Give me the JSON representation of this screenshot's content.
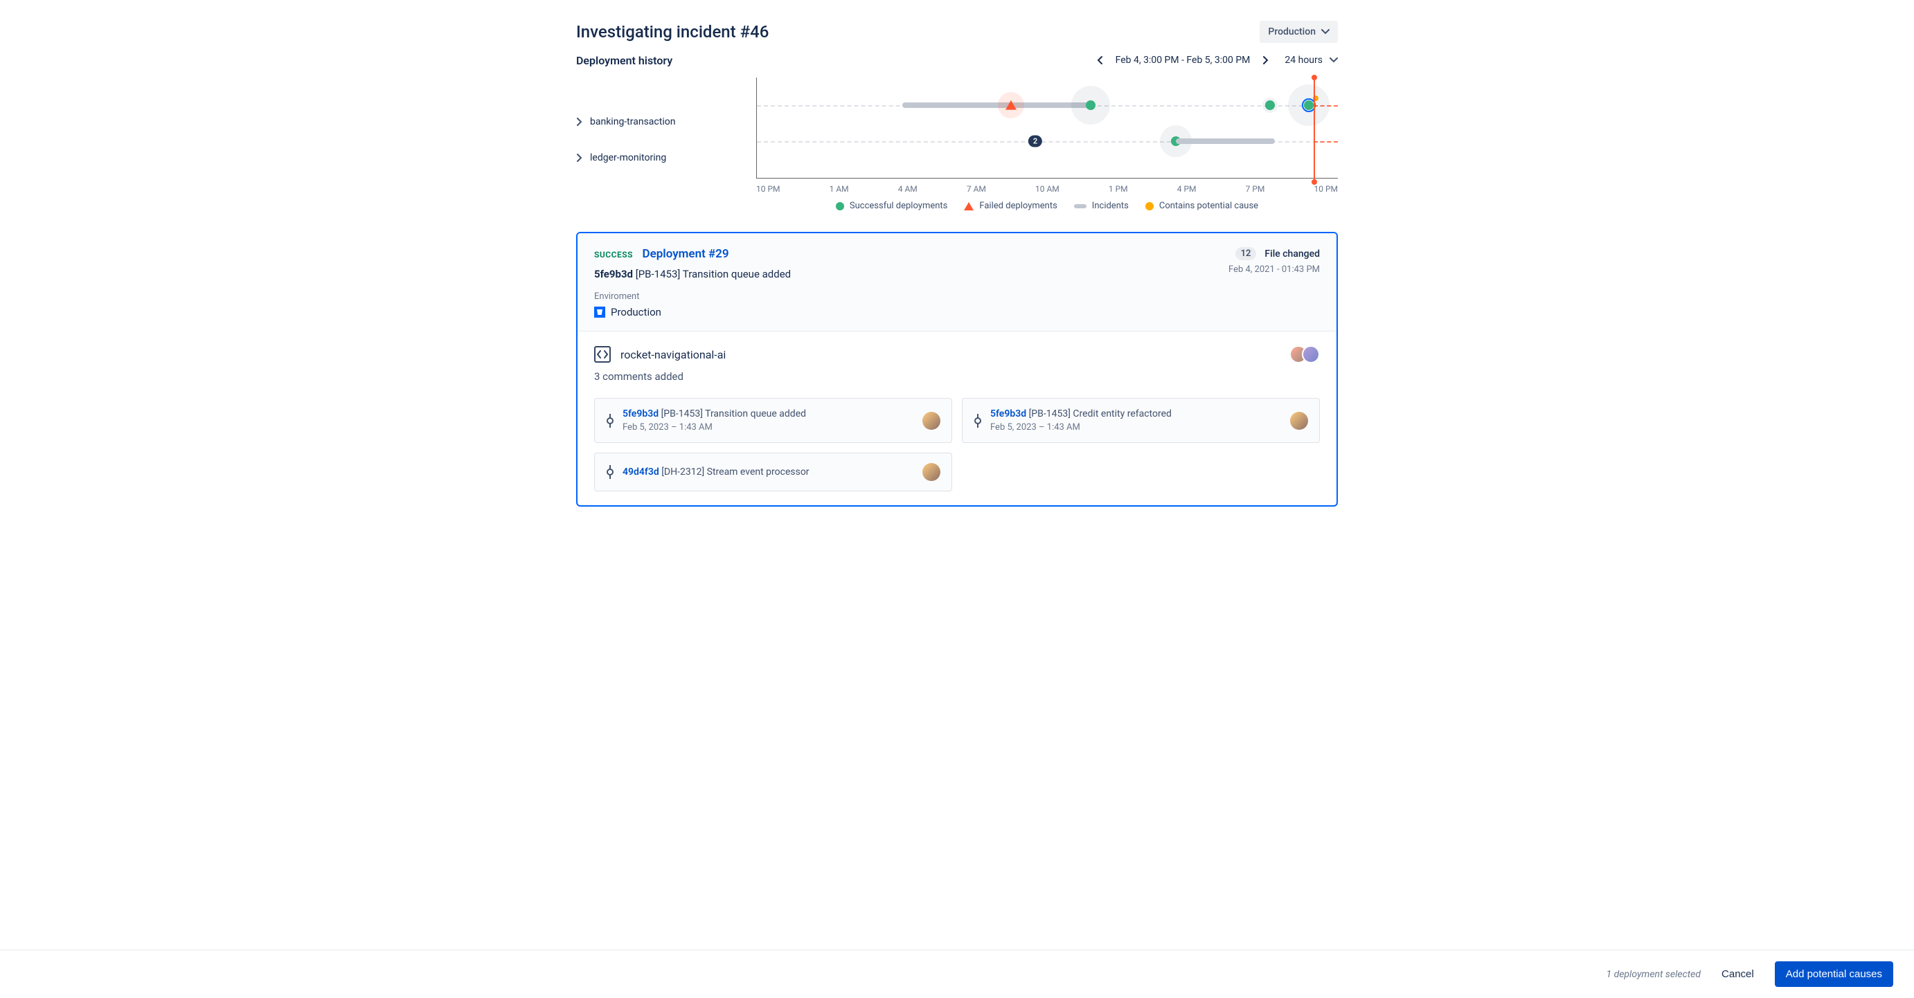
{
  "header": {
    "title": "Investigating incident #46",
    "env_select": "Production"
  },
  "subheader": {
    "subtitle": "Deployment history",
    "range": "Feb 4, 3:00 PM - Feb 5, 3:00 PM",
    "window": "24 hours"
  },
  "chart_data": {
    "type": "scatter",
    "xlabel": "",
    "ylabel": "",
    "x_ticks": [
      "10 PM",
      "1 AM",
      "4 AM",
      "7 AM",
      "10 AM",
      "1 PM",
      "4 PM",
      "7 PM",
      "10 PM"
    ],
    "now_marker_x": 21,
    "series": [
      {
        "name": "banking-transaction",
        "events": [
          {
            "type": "incident_bar",
            "start_hour": 4,
            "end_hour": 8.5
          },
          {
            "type": "incident_bar",
            "start_hour": 8,
            "end_hour": 11.8
          },
          {
            "type": "failed",
            "hour": 8.5,
            "halo": 38
          },
          {
            "type": "success",
            "hour": 11.8,
            "halo": 56
          },
          {
            "type": "success",
            "hour": 19.2,
            "halo": 22
          },
          {
            "type": "success",
            "hour": 20.8,
            "halo": 60,
            "potential_cause": true,
            "selected": true
          }
        ]
      },
      {
        "name": "ledger-monitoring",
        "events": [
          {
            "type": "cluster",
            "hour": 9.5,
            "count": 2
          },
          {
            "type": "success",
            "hour": 15.3,
            "halo": 46
          },
          {
            "type": "incident_bar",
            "start_hour": 15.3,
            "end_hour": 19.4
          }
        ]
      }
    ],
    "legend": [
      {
        "label": "Successful deployments",
        "kind": "success"
      },
      {
        "label": "Failed deployments",
        "kind": "failed"
      },
      {
        "label": "Incidents",
        "kind": "incident"
      },
      {
        "label": "Contains potential cause",
        "kind": "cause"
      }
    ]
  },
  "detail": {
    "status": "SUCCESS",
    "title": "Deployment #29",
    "commit_hash": "5fe9b3d",
    "commit_msg": "[PB-1453] Transition queue added",
    "file_changed_count": "12",
    "file_changed_label": "File changed",
    "timestamp": "Feb 4, 2021 - 01:43 PM",
    "env_label": "Enviroment",
    "env_value": "Production",
    "repo": "rocket-navigational-ai",
    "comments_added": "3 comments added",
    "commits": [
      {
        "hash": "5fe9b3d",
        "msg": "[PB-1453] Transition queue added",
        "date": "Feb 5, 2023 – 1:43 AM"
      },
      {
        "hash": "5fe9b3d",
        "msg": "[PB-1453] Credit entity refactored",
        "date": "Feb 5, 2023 – 1:43 AM"
      },
      {
        "hash": "49d4f3d",
        "msg": "[DH-2312] Stream event processor",
        "date": ""
      }
    ]
  },
  "footer": {
    "status": "1 deployment selected",
    "cancel": "Cancel",
    "primary": "Add potential causes"
  }
}
